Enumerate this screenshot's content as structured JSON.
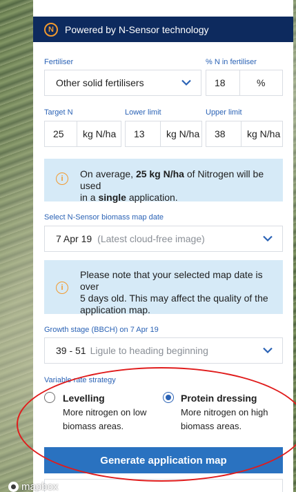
{
  "header": {
    "logo_letter": "N",
    "title": "Powered by N-Sensor technology"
  },
  "fertiliser": {
    "label": "Fertiliser",
    "value": "Other solid fertilisers",
    "percent_label": "% N in fertiliser",
    "percent_value": "18",
    "percent_unit": "%"
  },
  "targets": {
    "target_label": "Target N",
    "target_value": "25",
    "target_unit": "kg N/ha",
    "lower_label": "Lower limit",
    "lower_value": "13",
    "lower_unit": "kg N/ha",
    "upper_label": "Upper limit",
    "upper_value": "38",
    "upper_unit": "kg N/ha"
  },
  "info1": {
    "icon": "i",
    "line1_a": "On average, ",
    "line1_b": "25 kg N/ha",
    "line1_c": " of Nitrogen will be used",
    "line2_a": "in a ",
    "line2_b": "single",
    "line2_c": " application."
  },
  "map_date": {
    "label": "Select N-Sensor biomass map date",
    "value": "7 Apr 19",
    "hint": "(Latest cloud-free image)"
  },
  "info2": {
    "icon": "i",
    "line1": "Please note that your selected map date is over",
    "line2": "5 days old. This may affect the quality of the",
    "line3": "application map."
  },
  "growth": {
    "label": "Growth stage (BBCH) on 7 Apr 19",
    "value": "39 - 51",
    "hint": "Ligule to heading beginning"
  },
  "strategy": {
    "label": "Variable rate strategy",
    "options": [
      {
        "title": "Levelling",
        "desc1": "More nitrogen on low",
        "desc2": "biomass areas.",
        "selected": false
      },
      {
        "title": "Protein dressing",
        "desc1": "More nitrogen on high",
        "desc2": "biomass areas.",
        "selected": true
      }
    ]
  },
  "generate_button": "Generate application map",
  "map_attribution": "mapbox",
  "colors": {
    "header_bg": "#0d2a5e",
    "accent_blue": "#2a62b5",
    "button_blue": "#2a72c0",
    "info_bg": "#d6eaf7",
    "warning_orange": "#f29a2e",
    "annotation_red": "#e01b1b"
  }
}
